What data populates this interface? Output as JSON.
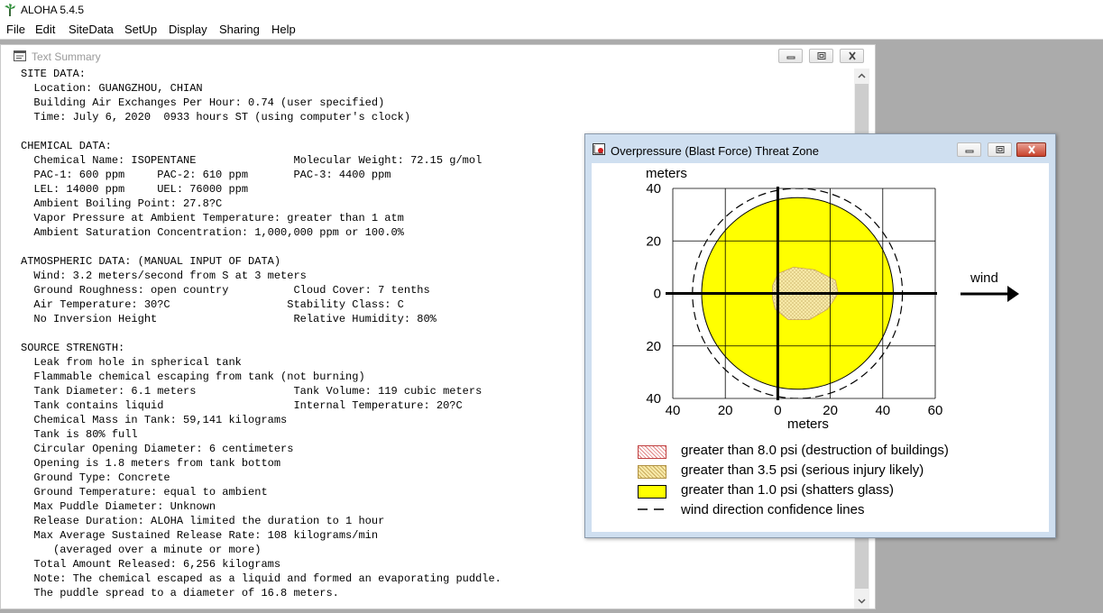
{
  "app": {
    "title": "ALOHA 5.4.5",
    "menu": [
      "File",
      "Edit",
      "SiteData",
      "SetUp",
      "Display",
      "Sharing",
      "Help"
    ]
  },
  "text_summary": {
    "title": "Text Summary",
    "lines": [
      "SITE DATA:",
      "  Location: GUANGZHOU, CHIAN",
      "  Building Air Exchanges Per Hour: 0.74 (user specified)",
      "  Time: July 6, 2020  0933 hours ST (using computer's clock)",
      "",
      "CHEMICAL DATA:",
      "  Chemical Name: ISOPENTANE               Molecular Weight: 72.15 g/mol",
      "  PAC-1: 600 ppm     PAC-2: 610 ppm       PAC-3: 4400 ppm",
      "  LEL: 14000 ppm     UEL: 76000 ppm",
      "  Ambient Boiling Point: 27.8?C",
      "  Vapor Pressure at Ambient Temperature: greater than 1 atm",
      "  Ambient Saturation Concentration: 1,000,000 ppm or 100.0%",
      "",
      "ATMOSPHERIC DATA: (MANUAL INPUT OF DATA)",
      "  Wind: 3.2 meters/second from S at 3 meters",
      "  Ground Roughness: open country          Cloud Cover: 7 tenths",
      "  Air Temperature: 30?C                  Stability Class: C",
      "  No Inversion Height                     Relative Humidity: 80%",
      "",
      "SOURCE STRENGTH:",
      "  Leak from hole in spherical tank",
      "  Flammable chemical escaping from tank (not burning)",
      "  Tank Diameter: 6.1 meters               Tank Volume: 119 cubic meters",
      "  Tank contains liquid                    Internal Temperature: 20?C",
      "  Chemical Mass in Tank: 59,141 kilograms",
      "  Tank is 80% full",
      "  Circular Opening Diameter: 6 centimeters",
      "  Opening is 1.8 meters from tank bottom",
      "  Ground Type: Concrete",
      "  Ground Temperature: equal to ambient",
      "  Max Puddle Diameter: Unknown",
      "  Release Duration: ALOHA limited the duration to 1 hour",
      "  Max Average Sustained Release Rate: 108 kilograms/min",
      "     (averaged over a minute or more)",
      "  Total Amount Released: 6,256 kilograms",
      "  Note: The chemical escaped as a liquid and formed an evaporating puddle.",
      "  The puddle spread to a diameter of 16.8 meters."
    ]
  },
  "threat_zone": {
    "title": "Overpressure (Blast Force) Threat Zone",
    "wind_label": "wind",
    "legend": [
      {
        "label": "greater than 8.0 psi (destruction of buildings)",
        "color": "#ffffff"
      },
      {
        "label": "greater than 3.5 psi (serious injury likely)",
        "color": "#f7e9a8"
      },
      {
        "label": "greater than 1.0 psi (shatters glass)",
        "color": "#ffff00"
      },
      {
        "label": "wind direction confidence lines",
        "color": "#000000"
      }
    ],
    "colors": {
      "zone_yellow": "#ffff00",
      "zone_orange": "#f7e9a8",
      "zone_red_dots": "#d04040"
    }
  },
  "chart_data": {
    "type": "area",
    "ylabel": "meters",
    "xlabel": "meters",
    "xlim": [
      -40,
      60
    ],
    "ylim": [
      -40,
      40
    ],
    "x_ticks": [
      -40,
      -20,
      0,
      20,
      40,
      60
    ],
    "x_tick_labels": [
      "40",
      "20",
      "0",
      "20",
      "40",
      "60"
    ],
    "y_ticks": [
      40,
      20,
      0,
      -20,
      -40
    ],
    "y_tick_labels": [
      "40",
      "20",
      "0",
      "20",
      "40"
    ],
    "grid": true,
    "zones": [
      {
        "label": "greater than 1.0 psi (shatters glass)",
        "shape": "circle",
        "center_x": 7.5,
        "center_y": 0,
        "radius": 36.5
      },
      {
        "label": "greater than 3.5 psi (serious injury likely)",
        "shape": "blob",
        "points": [
          [
            -2,
            3
          ],
          [
            0,
            7.5
          ],
          [
            6,
            10
          ],
          [
            14,
            9
          ],
          [
            22,
            5
          ],
          [
            23,
            0
          ],
          [
            19,
            -6
          ],
          [
            12,
            -10
          ],
          [
            4,
            -10
          ],
          [
            -1,
            -6
          ],
          [
            -2,
            -2
          ]
        ]
      }
    ],
    "confidence_line": {
      "center_x": 7.5,
      "center_y": 0,
      "radius": 40
    }
  }
}
